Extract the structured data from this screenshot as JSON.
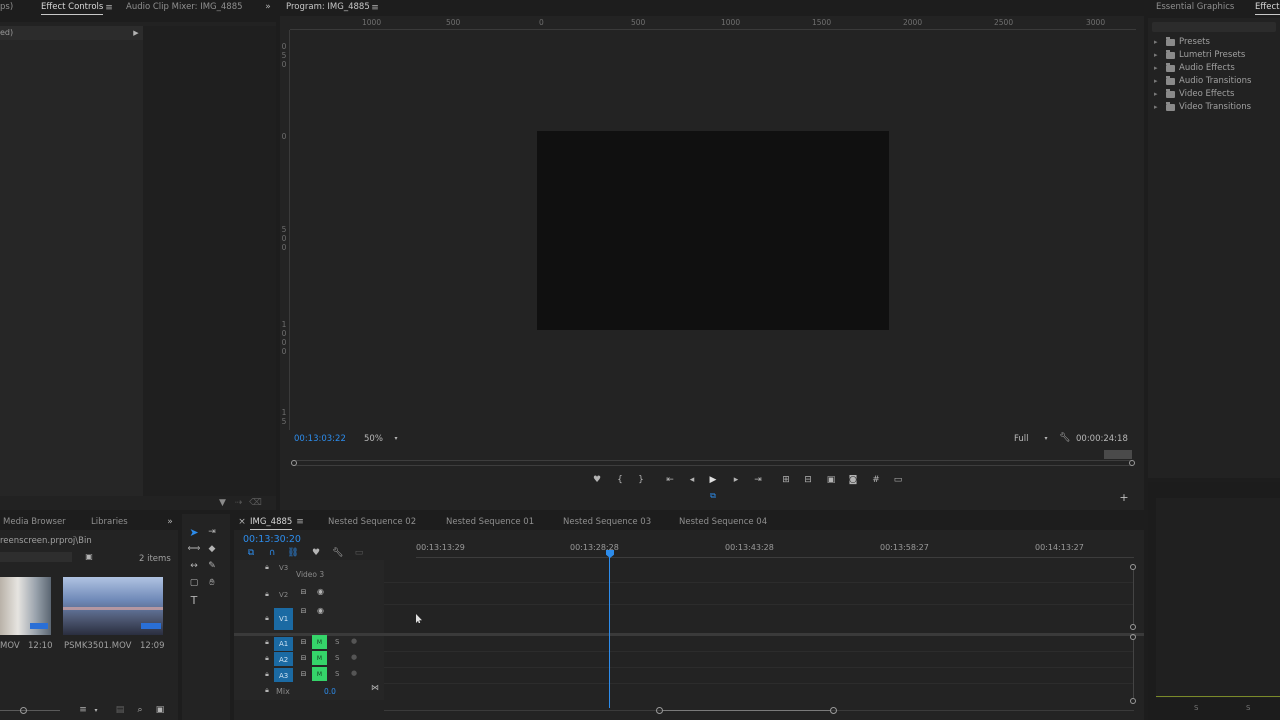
{
  "left_panel": {
    "tabs": [
      "ps)",
      "Effect Controls",
      "Audio Clip Mixer: IMG_4885"
    ],
    "menu_icon": "hamburger-icon",
    "overflow_label": "»",
    "row_label": "ed)"
  },
  "program_monitor": {
    "title": "Program: IMG_4885",
    "ruler_labels": [
      "1000",
      "500",
      "0",
      "500",
      "1000",
      "1500",
      "2000",
      "2500",
      "3000"
    ],
    "vertical_ruler_groups": [
      [
        "0",
        "5",
        "0"
      ],
      [
        "0"
      ],
      [
        "5",
        "0",
        "0"
      ],
      [
        "1",
        "0",
        "0",
        "0"
      ],
      [
        "1",
        "5"
      ]
    ],
    "timecode_current": "00:13:03:22",
    "zoom": "50%",
    "quality": "Full",
    "timecode_duration": "00:00:24:18",
    "transport_icons": [
      "marker-icon",
      "mark-in-icon",
      "mark-out-icon",
      "go-to-in-icon",
      "step-back-icon",
      "play-icon",
      "step-forward-icon",
      "go-to-out-icon",
      "lift-icon",
      "extract-icon",
      "insert-icon",
      "export-frame-icon",
      "safe-margins-icon",
      "comparison-icon"
    ]
  },
  "right_panel": {
    "tabs": [
      "Essential Graphics",
      "Effects"
    ],
    "tree": [
      "Presets",
      "Lumetri Presets",
      "Audio Effects",
      "Audio Transitions",
      "Video Effects",
      "Video Transitions"
    ]
  },
  "project_panel": {
    "tabs": [
      "Media Browser",
      "Libraries"
    ],
    "path": "reenscreen.prproj\\Bin",
    "item_count": "2 items",
    "items": [
      {
        "name": "MOV",
        "duration": "12:10"
      },
      {
        "name": "PSMK3501.MOV",
        "duration": "12:09"
      }
    ]
  },
  "timeline": {
    "tabs": [
      "IMG_4885",
      "Nested Sequence 02",
      "Nested Sequence 01",
      "Nested Sequence 03",
      "Nested Sequence 04"
    ],
    "timecode": "00:13:30:20",
    "ruler_labels": [
      "00:13:13:29",
      "00:13:28:28",
      "00:13:43:28",
      "00:13:58:27",
      "00:14:13:27"
    ],
    "video_tracks": [
      {
        "id": "V3",
        "name": "Video 3"
      },
      {
        "id": "V2",
        "name": ""
      },
      {
        "id": "V1",
        "name": ""
      }
    ],
    "audio_tracks": [
      {
        "id": "A1",
        "mute": "M",
        "solo": "S"
      },
      {
        "id": "A2",
        "mute": "M",
        "solo": "S"
      },
      {
        "id": "A3",
        "mute": "M",
        "solo": "S"
      }
    ],
    "mix_label": "Mix",
    "mix_value": "0.0"
  },
  "colors": {
    "accent_blue": "#2d8ceb",
    "mute_green": "#35d46a",
    "track_blue": "#1b6aa3"
  }
}
